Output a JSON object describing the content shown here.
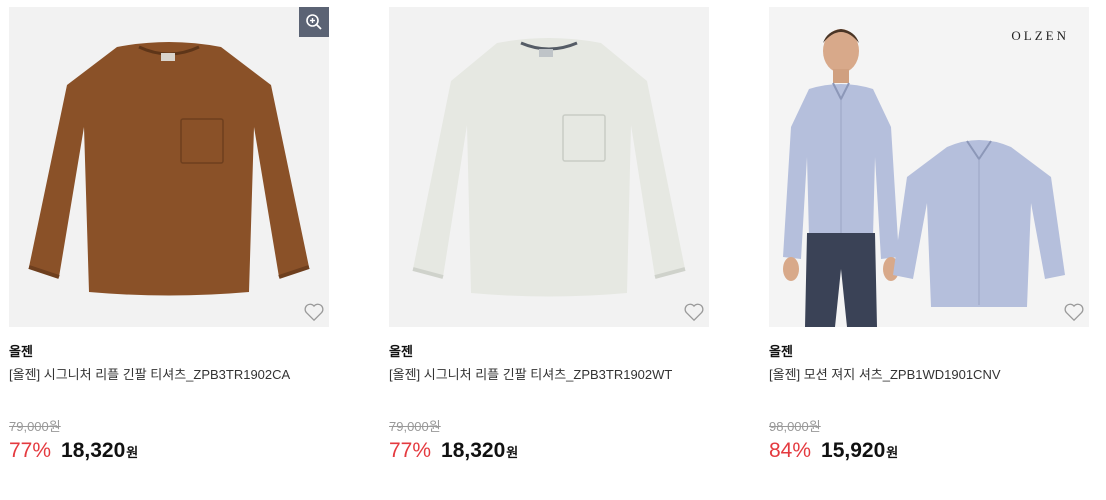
{
  "products": [
    {
      "brand": "올젠",
      "name": "[올젠] 시그니처 리플 긴팔 티셔츠_ZPB3TR1902CA",
      "original_price": "79,000원",
      "discount": "77%",
      "price": "18,320",
      "currency": "원",
      "shirt_color": "#8a5128",
      "image_bg": "#f2f2f2",
      "has_zoom": true,
      "zoom_icon": "zoom-in-icon",
      "wishlist_icon": "heart-outline-icon"
    },
    {
      "brand": "올젠",
      "name": "[올젠] 시그니처 리플 긴팔 티셔츠_ZPB3TR1902WT",
      "original_price": "79,000원",
      "discount": "77%",
      "price": "18,320",
      "currency": "원",
      "shirt_color": "#e6e8e2",
      "image_bg": "#f2f2f2",
      "has_zoom": false,
      "wishlist_icon": "heart-outline-icon"
    },
    {
      "brand": "올젠",
      "name": "[올젠] 모션 져지 셔츠_ZPB1WD1901CNV",
      "original_price": "98,000원",
      "discount": "84%",
      "price": "15,920",
      "currency": "원",
      "image_logo_text": "OLZEN",
      "shirt_color": "#b5bfdc",
      "pants_color": "#3a4256",
      "image_bg": "#f4f4f4",
      "has_zoom": false,
      "wishlist_icon": "heart-outline-icon"
    }
  ],
  "colors": {
    "discount": "#e43a3f",
    "zoom_button_bg": "#5b6374",
    "original_price": "#999999"
  }
}
